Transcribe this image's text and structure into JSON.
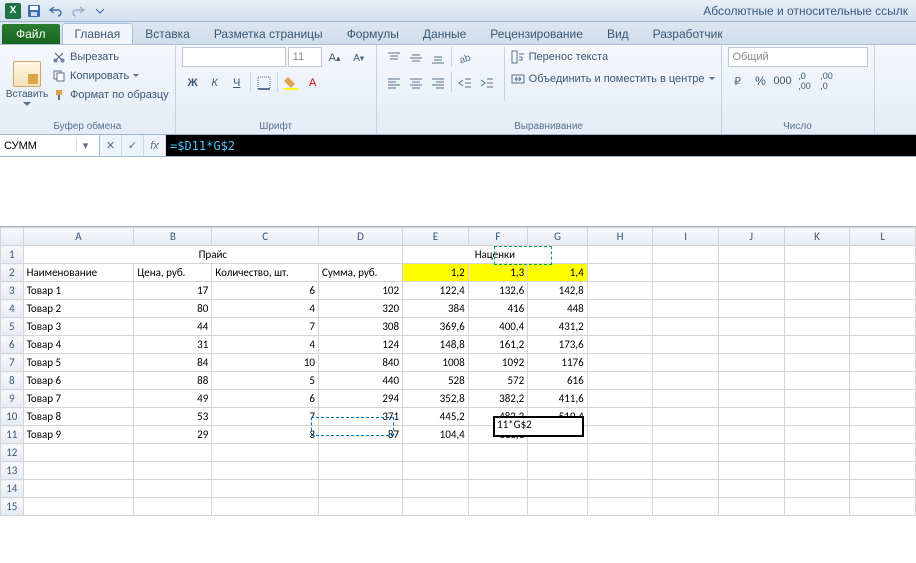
{
  "app_title": "Абсолютные и относительные ссылк",
  "ribbon": {
    "file_label": "Файл",
    "tabs": [
      "Главная",
      "Вставка",
      "Разметка страницы",
      "Формулы",
      "Данные",
      "Рецензирование",
      "Вид",
      "Разработчик"
    ],
    "active_tab_index": 0,
    "groups": {
      "clipboard": {
        "label": "Буфер обмена",
        "paste": "Вставить",
        "cut": "Вырезать",
        "copy": "Копировать",
        "format": "Формат по образцу"
      },
      "font": {
        "label": "Шрифт",
        "name": "",
        "size": "11"
      },
      "alignment": {
        "label": "Выравнивание",
        "wrap": "Перенос текста",
        "merge": "Объединить и поместить в центре"
      },
      "number": {
        "label": "Число",
        "format": "Общий"
      }
    }
  },
  "formula_bar": {
    "name_box": "СУММ",
    "formula": "=$D11*G$2"
  },
  "grid": {
    "col_headers": [
      "A",
      "B",
      "C",
      "D",
      "E",
      "F",
      "G",
      "H",
      "I",
      "J",
      "K",
      "L"
    ],
    "merged_title_price": "Прайс",
    "merged_title_markup": "Наценки",
    "header_row": {
      "A": "Наименование",
      "B": "Цена, руб.",
      "C": "Количество, шт.",
      "D": "Сумма, руб.",
      "E": "1,2",
      "F": "1,3",
      "G": "1,4"
    },
    "rows": [
      {
        "A": "Товар 1",
        "B": "17",
        "C": "6",
        "D": "102",
        "E": "122,4",
        "F": "132,6",
        "G": "142,8"
      },
      {
        "A": "Товар 2",
        "B": "80",
        "C": "4",
        "D": "320",
        "E": "384",
        "F": "416",
        "G": "448"
      },
      {
        "A": "Товар 3",
        "B": "44",
        "C": "7",
        "D": "308",
        "E": "369,6",
        "F": "400,4",
        "G": "431,2"
      },
      {
        "A": "Товар 4",
        "B": "31",
        "C": "4",
        "D": "124",
        "E": "148,8",
        "F": "161,2",
        "G": "173,6"
      },
      {
        "A": "Товар 5",
        "B": "84",
        "C": "10",
        "D": "840",
        "E": "1008",
        "F": "1092",
        "G": "1176"
      },
      {
        "A": "Товар 6",
        "B": "88",
        "C": "5",
        "D": "440",
        "E": "528",
        "F": "572",
        "G": "616"
      },
      {
        "A": "Товар 7",
        "B": "49",
        "C": "6",
        "D": "294",
        "E": "352,8",
        "F": "382,2",
        "G": "411,6"
      },
      {
        "A": "Товар 8",
        "B": "53",
        "C": "7",
        "D": "371",
        "E": "445,2",
        "F": "482,3",
        "G": "519,4"
      },
      {
        "A": "Товар 9",
        "B": "29",
        "C": "3",
        "D": "87",
        "E": "104,4",
        "F": "113,1",
        "G": ""
      }
    ],
    "active_cell_display": "11*G$2",
    "row_count": 15
  }
}
